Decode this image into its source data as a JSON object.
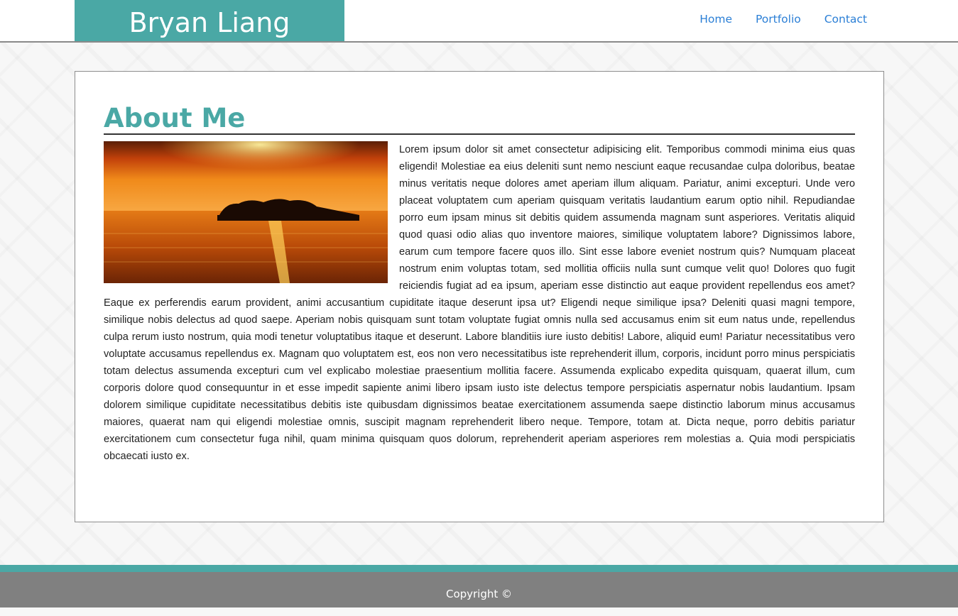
{
  "header": {
    "brand": "Bryan Liang",
    "nav": [
      "Home",
      "Portfolio",
      "Contact"
    ]
  },
  "main": {
    "title": "About Me",
    "paragraph": "Lorem ipsum dolor sit amet consectetur adipisicing elit. Temporibus commodi minima eius quas eligendi! Molestiae ea eius deleniti sunt nemo nesciunt eaque recusandae culpa doloribus, beatae minus veritatis neque dolores amet aperiam illum aliquam. Pariatur, animi excepturi. Unde vero placeat voluptatem cum aperiam quisquam veritatis laudantium earum optio nihil. Repudiandae porro eum ipsam minus sit debitis quidem assumenda magnam sunt asperiores. Veritatis aliquid quod quasi odio alias quo inventore maiores, similique voluptatem labore? Dignissimos labore, earum cum tempore facere quos illo. Sint esse labore eveniet nostrum quis? Numquam placeat nostrum enim voluptas totam, sed mollitia officiis nulla sunt cumque velit quo! Dolores quo fugit reiciendis fugiat ad ea ipsum, aperiam esse distinctio aut eaque provident repellendus eos amet? Eaque ex perferendis earum provident, animi accusantium cupiditate itaque deserunt ipsa ut? Eligendi neque similique ipsa? Deleniti quasi magni tempore, similique nobis delectus ad quod saepe. Aperiam nobis quisquam sunt totam voluptate fugiat omnis nulla sed accusamus enim sit eum natus unde, repellendus culpa rerum iusto nostrum, quia modi tenetur voluptatibus itaque et deserunt. Labore blanditiis iure iusto debitis! Labore, aliquid eum! Pariatur necessitatibus vero voluptate accusamus repellendus ex. Magnam quo voluptatem est, eos non vero necessitatibus iste reprehenderit illum, corporis, incidunt porro minus perspiciatis totam delectus assumenda excepturi cum vel explicabo molestiae praesentium mollitia facere. Assumenda explicabo expedita quisquam, quaerat illum, cum corporis dolore quod consequuntur in et esse impedit sapiente animi libero ipsam iusto iste delectus tempore perspiciatis aspernatur nobis laudantium. Ipsam dolorem similique cupiditate necessitatibus debitis iste quibusdam dignissimos beatae exercitationem assumenda saepe distinctio laborum minus accusamus maiores, quaerat nam qui eligendi molestiae omnis, suscipit magnam reprehenderit libero neque. Tempore, totam at. Dicta neque, porro debitis pariatur exercitationem cum consectetur fuga nihil, quam minima quisquam quos dolorum, reprehenderit aperiam asperiores rem molestias a. Quia modi perspiciatis obcaecati iusto ex."
  },
  "footer": {
    "copyright": "Copyright ©"
  },
  "colors": {
    "accent": "#4aa8a5",
    "link": "#2b7fd6",
    "footer": "#808080"
  }
}
